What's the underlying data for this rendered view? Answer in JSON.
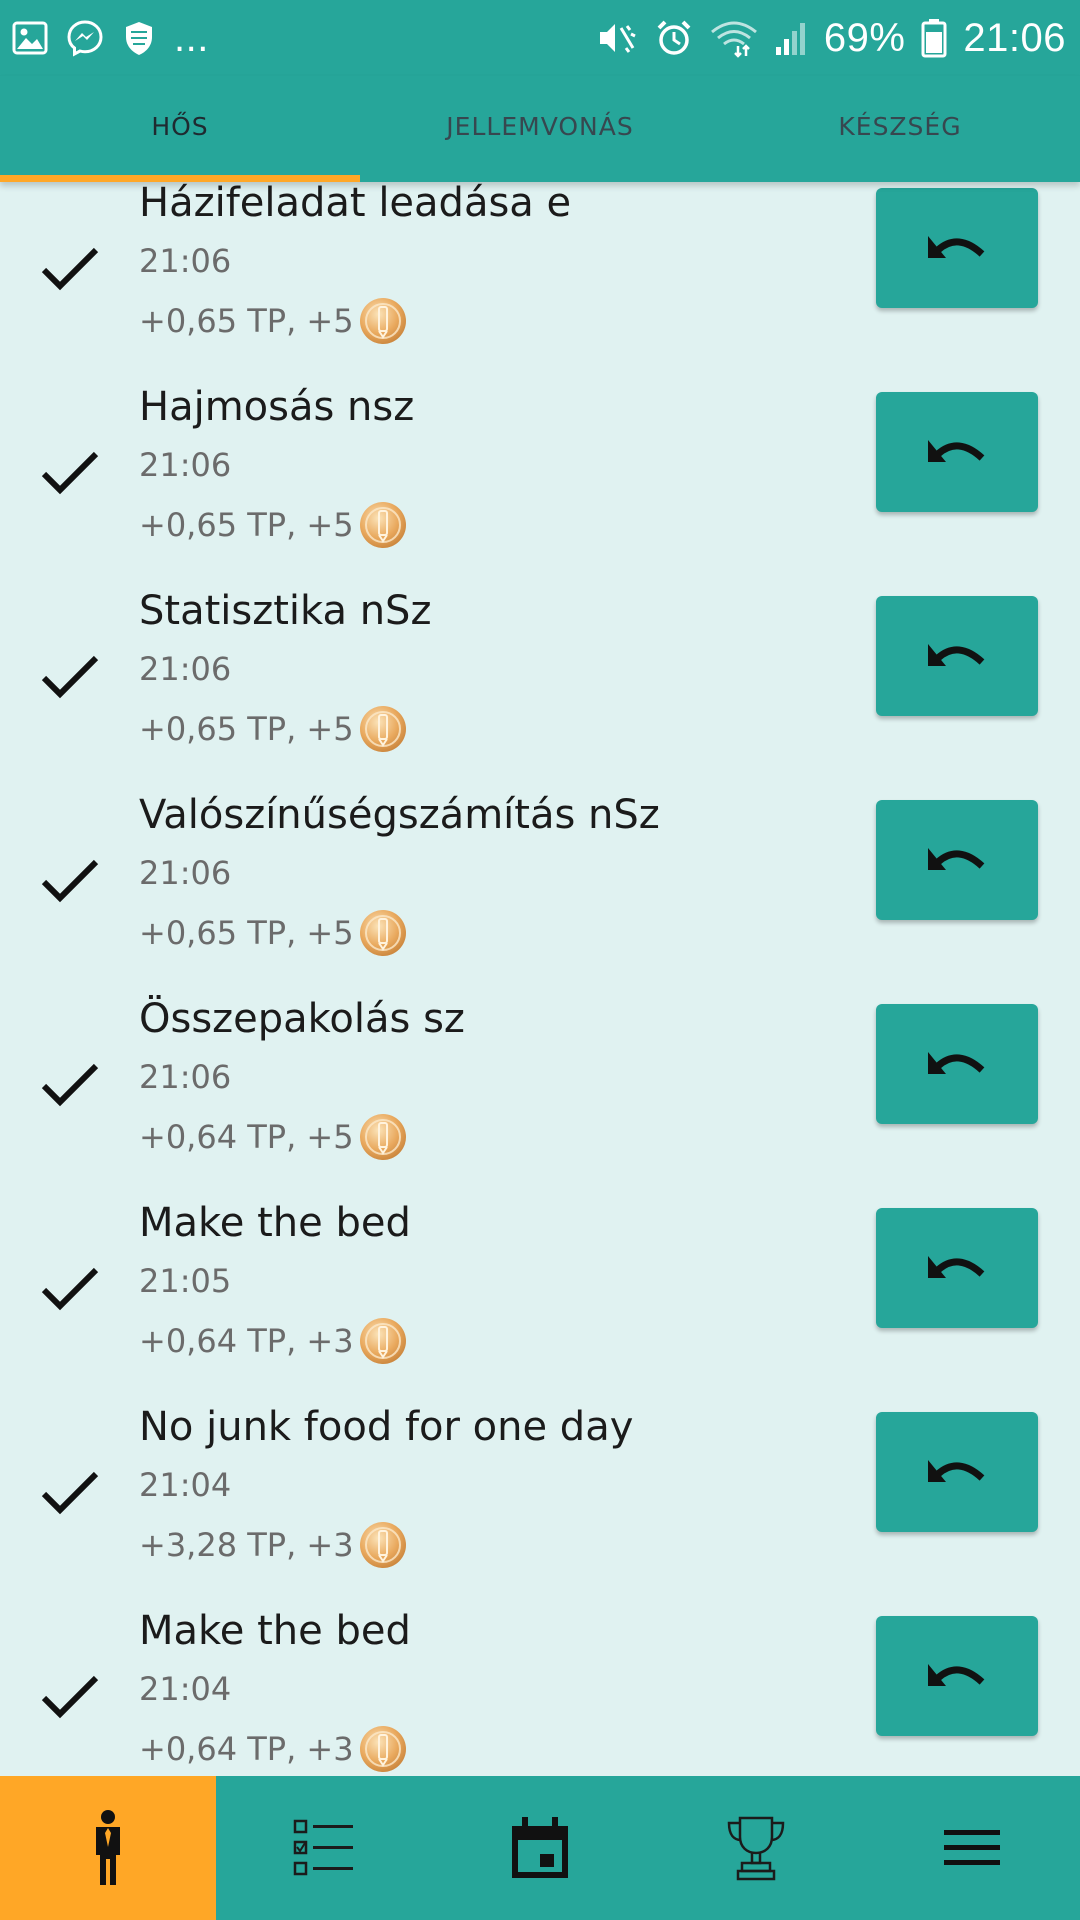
{
  "status_bar": {
    "battery_percent": "69%",
    "time": "21:06",
    "notification_overflow": "...",
    "left_icons": [
      "gallery-icon",
      "messenger-icon",
      "shield-app-icon"
    ],
    "right_icons": [
      "mute-vibrate-icon",
      "alarm-icon",
      "wifi-icon",
      "signal-icon",
      "battery-icon"
    ]
  },
  "tabs": [
    {
      "label": "HŐS",
      "active": true
    },
    {
      "label": "JELLEMVONÁS",
      "active": false
    },
    {
      "label": "KÉSZSÉG",
      "active": false
    }
  ],
  "history": [
    {
      "title": "Házifeladat leadása e",
      "time": "21:06",
      "reward": "+0,65 TP, +5"
    },
    {
      "title": "Hajmosás nsz",
      "time": "21:06",
      "reward": "+0,65 TP, +5"
    },
    {
      "title": "Statisztika nSz",
      "time": "21:06",
      "reward": "+0,65 TP, +5"
    },
    {
      "title": "Valószínűségszámítás nSz",
      "time": "21:06",
      "reward": "+0,65 TP, +5"
    },
    {
      "title": "Összepakolás sz",
      "time": "21:06",
      "reward": "+0,64 TP, +5"
    },
    {
      "title": "Make the bed",
      "time": "21:05",
      "reward": "+0,64 TP, +3"
    },
    {
      "title": "No junk food for one day",
      "time": "21:04",
      "reward": "+3,28 TP, +3"
    },
    {
      "title": "Make the bed",
      "time": "21:04",
      "reward": "+0,64 TP, +3"
    }
  ],
  "bottom_nav": [
    {
      "icon": "hero-person-icon",
      "active": true
    },
    {
      "icon": "checklist-icon",
      "active": false
    },
    {
      "icon": "calendar-icon",
      "active": false
    },
    {
      "icon": "trophy-icon",
      "active": false
    },
    {
      "icon": "menu-icon",
      "active": false
    }
  ],
  "colors": {
    "primary": "#26a69a",
    "accent": "#ffa726",
    "background": "#e0f2f1",
    "coin": "#e0a45a"
  }
}
